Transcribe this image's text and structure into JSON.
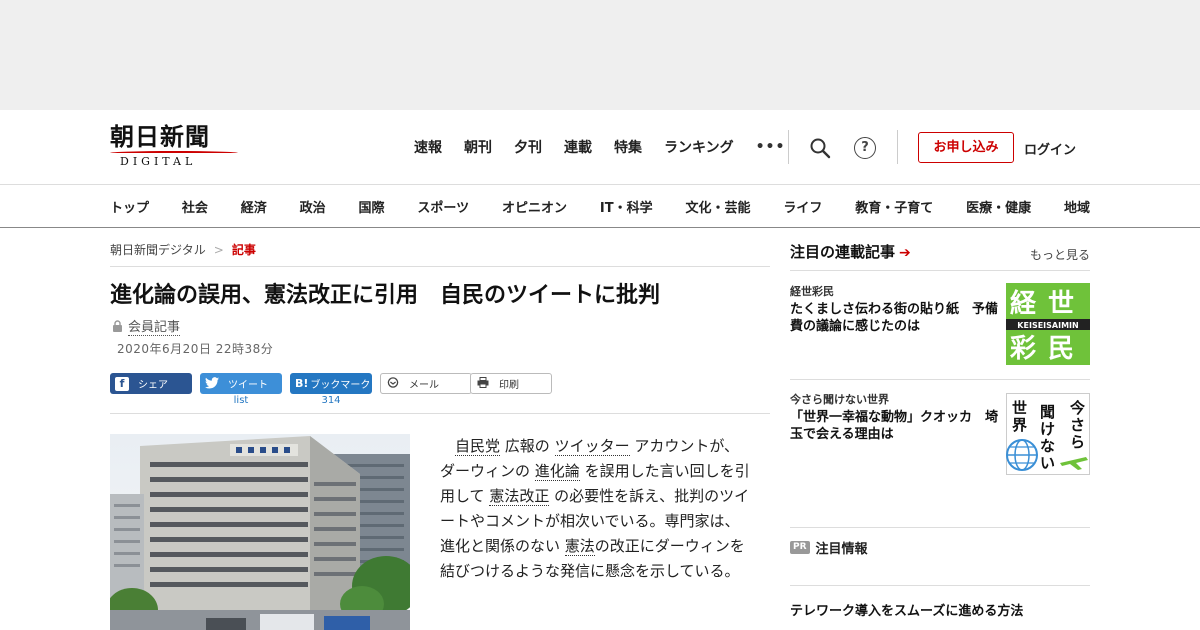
{
  "header": {
    "logo_jp": "朝日新聞",
    "logo_en": "DIGITAL",
    "nav": [
      "速報",
      "朝刊",
      "夕刊",
      "連載",
      "特集",
      "ランキング"
    ],
    "more_label": "•••",
    "help_label": "?",
    "subscribe_label": "お申し込み",
    "login_label": "ログイン"
  },
  "categories": [
    "トップ",
    "社会",
    "経済",
    "政治",
    "国際",
    "スポーツ",
    "オピニオン",
    "IT・科学",
    "文化・芸能",
    "ライフ",
    "教育・子育て",
    "医療・健康",
    "地域"
  ],
  "breadcrumb": {
    "home": "朝日新聞デジタル",
    "separator": ">",
    "current": "記事"
  },
  "article": {
    "title": "進化論の誤用、憲法改正に引用　自民のツイートに批判",
    "member_label": "会員記事",
    "date": "2020年6月20日 22時38分",
    "body": [
      {
        "t": "自民党",
        "kw": true
      },
      {
        "t": " 広報の ",
        "kw": false
      },
      {
        "t": "ツイッター",
        "kw": true
      },
      {
        "t": " アカウントが、ダーウィンの ",
        "kw": false
      },
      {
        "t": "進化論",
        "kw": true
      },
      {
        "t": " を誤用した言い回しを引用して ",
        "kw": false
      },
      {
        "t": "憲法改正",
        "kw": true
      },
      {
        "t": " の必要性を訴え、批判のツイートやコメントが相次いでいる。専門家は、進化と関係のない ",
        "kw": false
      },
      {
        "t": "憲法",
        "kw": true
      },
      {
        "t": "の改正にダーウィンを結びつけるような発信に懸念を示している。",
        "kw": false
      }
    ]
  },
  "share": {
    "facebook": {
      "icon": "f",
      "label": "シェア"
    },
    "twitter": {
      "label": "ツイート",
      "count": "list"
    },
    "hatena": {
      "icon": "B!",
      "label": "ブックマーク",
      "count": "314"
    },
    "mail": {
      "label": "メール"
    },
    "print": {
      "label": "印刷"
    }
  },
  "sidebar": {
    "title": "注目の連載記事",
    "arrow": "➔",
    "more_label": "もっと見る",
    "items": [
      {
        "kicker": "経世彩民",
        "headline": "たくましさ伝わる街の貼り紙　予備費の議論に感じたのは",
        "thumb_chars": [
          "経",
          "世",
          "彩",
          "民"
        ],
        "thumb_sub": "KEISEISAIMIN"
      },
      {
        "kicker": "今さら聞けない世界",
        "headline": "「世界一幸福な動物」クオッカ　埼玉で会える理由は",
        "thumb_col_right": [
          "今",
          "さ",
          "ら"
        ],
        "thumb_col_mid": [
          "聞",
          "け",
          "な",
          "い"
        ],
        "thumb_col_left": [
          "世",
          "界"
        ]
      }
    ],
    "pr_badge": "PR",
    "pr_title": "注目情報",
    "pr_headline": "テレワーク導入をスムーズに進める方法"
  },
  "colors": {
    "brand_red": "#cc0000",
    "facebook": "#2b5592",
    "twitter": "#3d8fd8",
    "hatena": "#2477c2",
    "keisei_green": "#6fc23a"
  }
}
